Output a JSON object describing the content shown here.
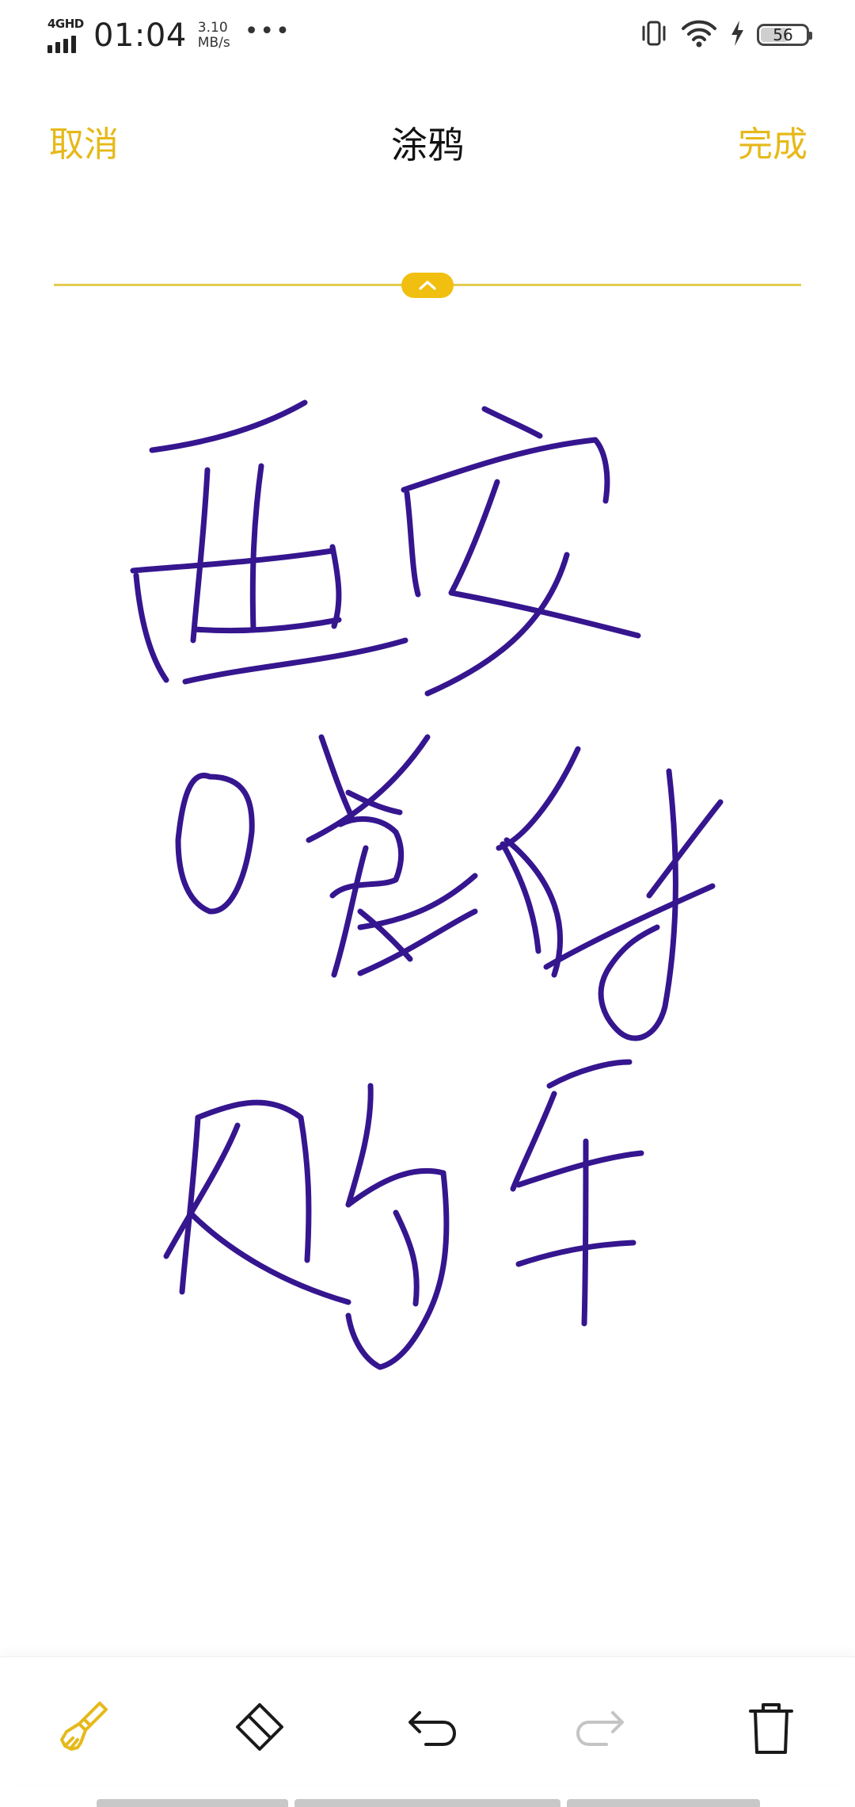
{
  "status_bar": {
    "network_type": "4GHD",
    "time": "01:04",
    "speed_value": "3.10",
    "speed_unit": "MB/s",
    "more_indicator": "•••",
    "icons": [
      "vibrate-icon",
      "wifi-icon",
      "charging-icon",
      "battery-icon"
    ],
    "battery_level": "56"
  },
  "header": {
    "cancel_label": "取消",
    "title": "涂鸦",
    "done_label": "完成"
  },
  "colors": {
    "accent": "#e6b91a",
    "handle": "#f1bf10",
    "divider": "#e2cc4f",
    "ink": "#35168f",
    "toolbar_icon": "#1a1a1a",
    "disabled_icon": "#c4c4c4"
  },
  "canvas": {
    "content_description_hidden": true
  },
  "toolbar": {
    "tools": [
      {
        "name": "brush",
        "icon": "brush-icon",
        "active": true
      },
      {
        "name": "eraser",
        "icon": "eraser-icon",
        "active": false
      },
      {
        "name": "undo",
        "icon": "undo-icon",
        "enabled": true
      },
      {
        "name": "redo",
        "icon": "redo-icon",
        "enabled": false
      },
      {
        "name": "delete",
        "icon": "trash-icon",
        "enabled": true
      }
    ]
  }
}
